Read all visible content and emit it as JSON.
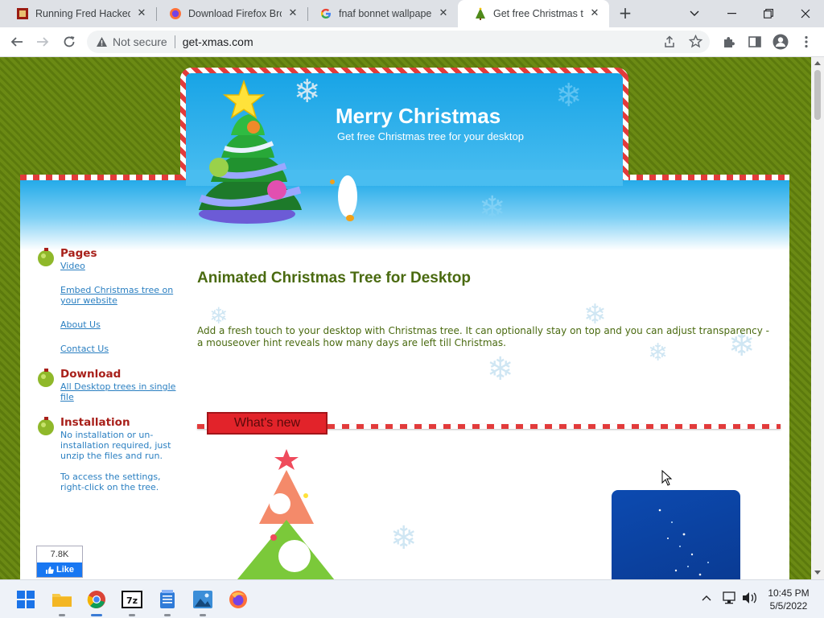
{
  "tabs": [
    {
      "title": "Running Fred Hacked |",
      "icon": "fred-favicon",
      "active": false
    },
    {
      "title": "Download Firefox Brow",
      "icon": "firefox-favicon",
      "active": false
    },
    {
      "title": "fnaf bonnet wallpaper",
      "icon": "google-favicon",
      "active": false
    },
    {
      "title": "Get free Christmas tree",
      "icon": "christmas-tree-favicon",
      "active": true
    }
  ],
  "toolbar": {
    "security_label": "Not secure",
    "url": "get-xmas.com"
  },
  "header": {
    "title": "Merry Christmas",
    "subtitle": "Get free Christmas tree for your desktop"
  },
  "sidebar": {
    "pages_heading": "Pages",
    "pages_links": [
      "Video",
      "Embed Christmas tree on your website",
      "About Us",
      "Contact Us"
    ],
    "download_heading": "Download",
    "download_link": "All Desktop trees in single file",
    "installation_heading": "Installation",
    "installation_text1": "No installation or un-installation required, just unzip the files and run.",
    "installation_text2": "To access the settings, right-click on the tree."
  },
  "facebook": {
    "count": "7.8K",
    "label": "Like"
  },
  "main": {
    "heading": "Animated Christmas Tree for Desktop",
    "intro": "Add a fresh touch to your desktop with Christmas tree. It can optionally stay on top and you can adjust transparency - a mouseover hint reveals how many days are left till Christmas.",
    "whats_new": "What's new"
  },
  "clock": {
    "time": "10:45 PM",
    "date": "5/5/2022"
  },
  "colors": {
    "accent_green": "#4a6a10",
    "link_blue": "#2a7fc1",
    "heading_red": "#a8201a",
    "sky_blue": "#1ea8e8"
  }
}
